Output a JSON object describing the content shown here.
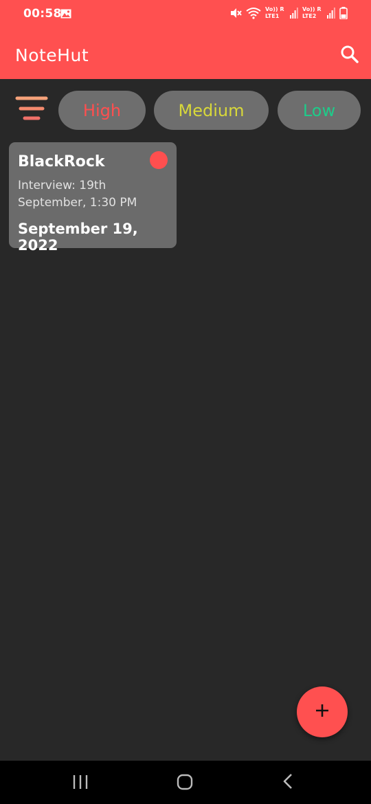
{
  "status_bar": {
    "time": "00:58",
    "sim1": {
      "top": "Vo)) R",
      "bottom": "LTE1"
    },
    "sim2": {
      "top": "Vo)) R",
      "bottom": "LTE2"
    },
    "icons": [
      "gallery-icon",
      "mute-icon",
      "wifi-icon",
      "signal-icon",
      "battery-icon"
    ]
  },
  "app_bar": {
    "title": "NoteHut",
    "search_icon": "search-icon"
  },
  "filters": {
    "sort_icon": "sort-icon",
    "chips": [
      {
        "label": "High",
        "color": "#FF4F4F"
      },
      {
        "label": "Medium",
        "color": "#D8D83A"
      },
      {
        "label": "Low",
        "color": "#1ECC8A"
      }
    ]
  },
  "notes": [
    {
      "title": "BlackRock",
      "body": "Interview: 19th September, 1:30 PM",
      "date": "September 19, 2022",
      "priority_color": "#FF4F4F"
    }
  ],
  "fab": {
    "icon": "plus-icon"
  },
  "nav_bar": {
    "icons": [
      "recents-icon",
      "home-icon",
      "back-icon"
    ]
  },
  "colors": {
    "accent": "#FF5050",
    "background": "#282828",
    "card": "#6B6B6B",
    "chip": "#6E6E6E"
  }
}
